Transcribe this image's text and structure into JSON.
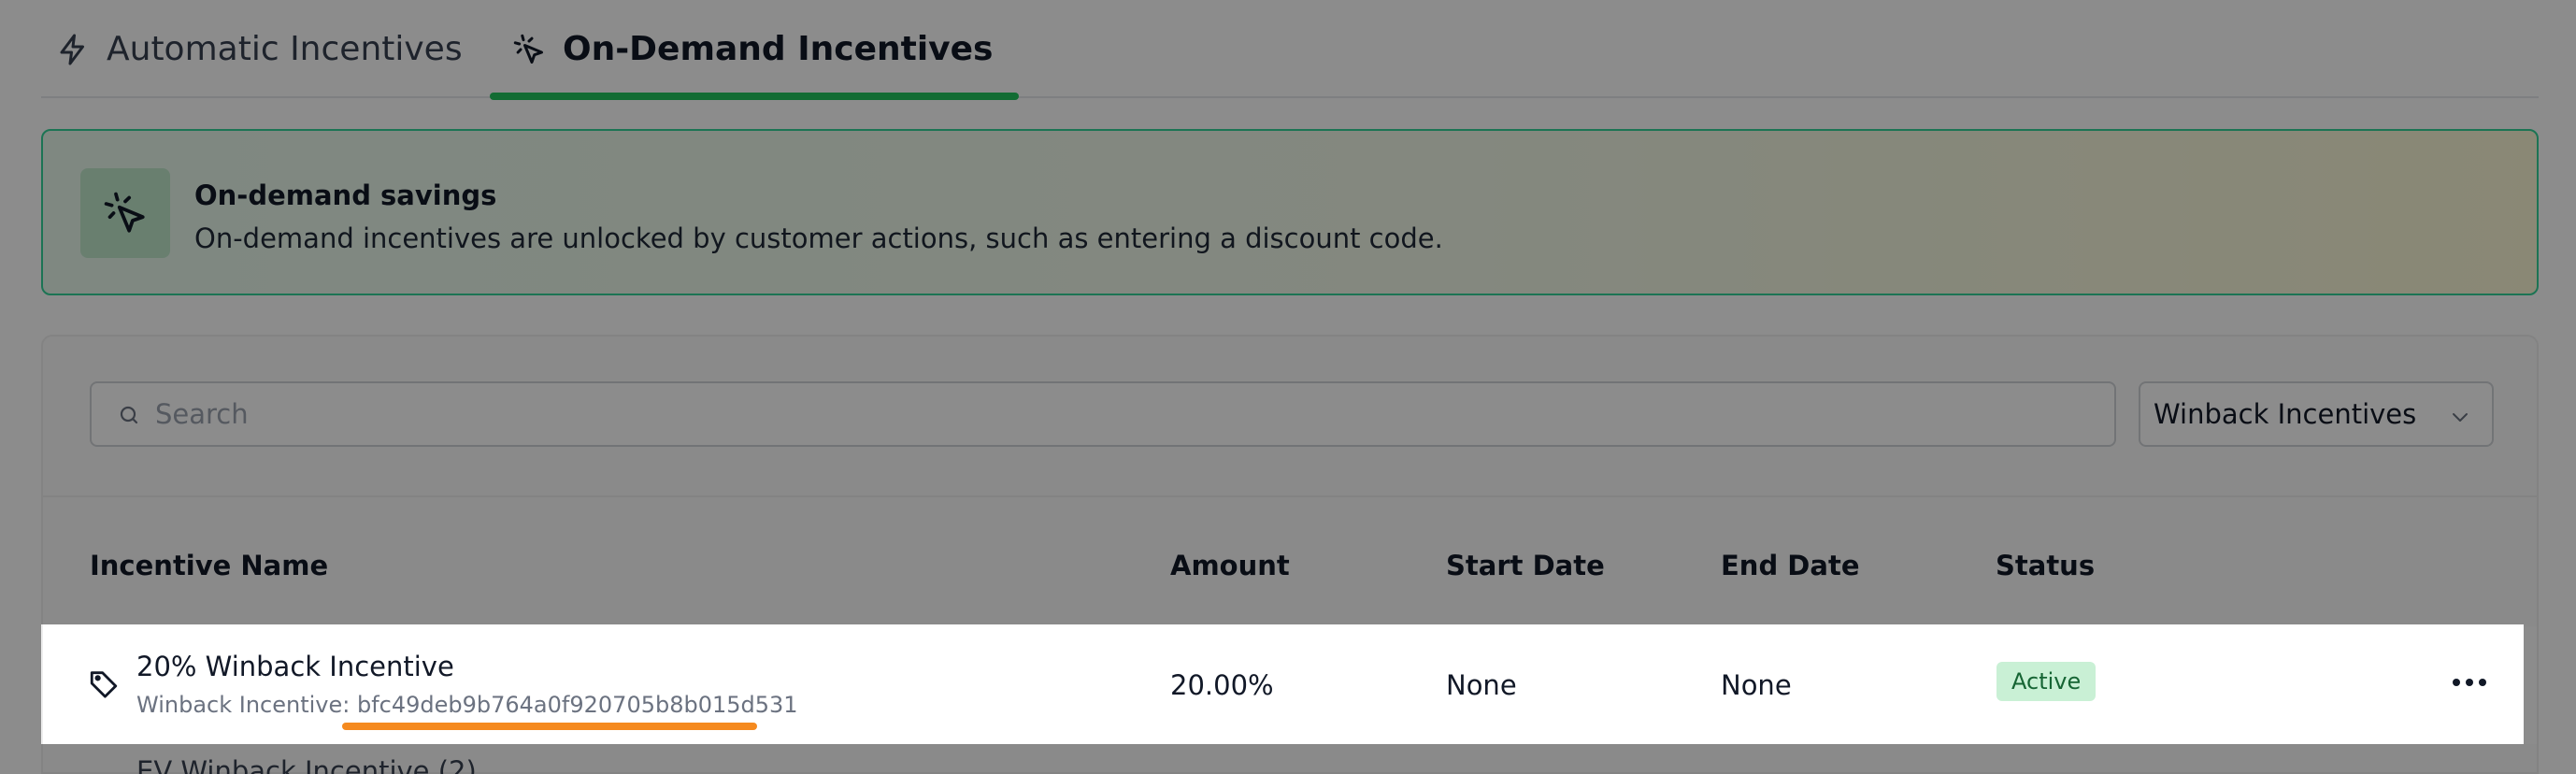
{
  "tabs": [
    {
      "label": "Automatic Incentives",
      "icon": "lightning-icon",
      "active": false
    },
    {
      "label": "On-Demand Incentives",
      "icon": "cursor-click-icon",
      "active": true
    }
  ],
  "banner": {
    "icon": "cursor-click-icon",
    "title": "On-demand savings",
    "text": "On-demand incentives are unlocked by customer actions, such as entering a discount code."
  },
  "search": {
    "placeholder": "Search",
    "value": ""
  },
  "filter": {
    "selected": "Winback Incentives"
  },
  "table": {
    "columns": [
      "Incentive Name",
      "Amount",
      "Start Date",
      "End Date",
      "Status"
    ],
    "rows": [
      {
        "name": "20% Winback Incentive",
        "subtitle_prefix": "Winback Incentive: ",
        "subtitle_id": "bfc49deb9b764a0f920705b8b015d531",
        "amount": "20.00%",
        "start_date": "None",
        "end_date": "None",
        "status": "Active"
      }
    ],
    "partial_row_text": "EV Winback Incentive (2)"
  },
  "colors": {
    "accent": "#22c55e",
    "banner_border": "#34d399",
    "highlight_underline": "#f58a1f",
    "status_active_bg": "#c9f0d5",
    "status_active_text": "#166534"
  }
}
